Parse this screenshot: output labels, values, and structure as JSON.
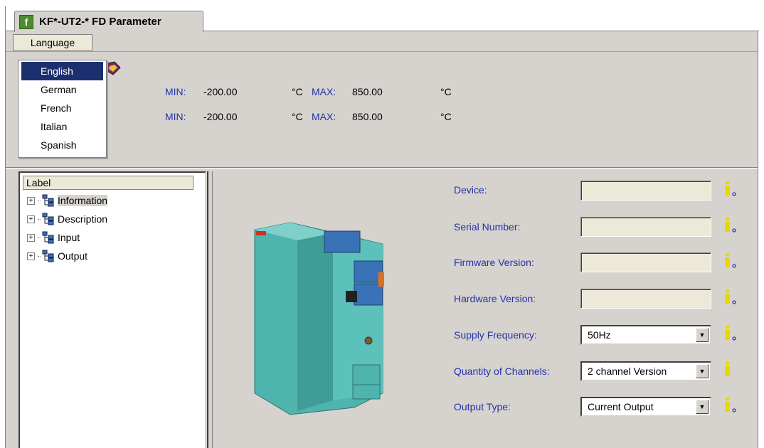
{
  "tab": {
    "logo": "f",
    "title": "KF*-UT2-* FD Parameter"
  },
  "menu": {
    "language_label": "Language"
  },
  "language_menu": {
    "items": [
      "English",
      "German",
      "French",
      "Italian",
      "Spanish"
    ],
    "selected": "English"
  },
  "ranges": [
    {
      "value": "0",
      "min_label": "MIN:",
      "min_value": "-200.00",
      "unit1": "°C",
      "max_label": "MAX:",
      "max_value": "850.00",
      "unit2": "°C"
    },
    {
      "value": "0",
      "min_label": "MIN:",
      "min_value": "-200.00",
      "unit1": "°C",
      "max_label": "MAX:",
      "max_value": "850.00",
      "unit2": "°C"
    }
  ],
  "tree": {
    "header": "Label",
    "items": [
      "Information",
      "Description",
      "Input",
      "Output"
    ],
    "selected": "Information"
  },
  "fields": {
    "device": {
      "label": "Device:",
      "value": ""
    },
    "serial_number": {
      "label": "Serial Number:",
      "value": ""
    },
    "firmware_version": {
      "label": "Firmware Version:",
      "value": ""
    },
    "hardware_version": {
      "label": "Hardware Version:",
      "value": ""
    },
    "supply_frequency": {
      "label": "Supply Frequency:",
      "value": "50Hz"
    },
    "quantity_of_channels": {
      "label": "Quantity of Channels:",
      "value": "2 channel Version"
    },
    "output_type": {
      "label": "Output Type:",
      "value": "Current Output"
    }
  },
  "colors": {
    "label_blue": "#2233aa",
    "highlight": "#1c2f6f",
    "panel": "#d6d3ce",
    "info_yellow": "#e8d800",
    "device_teal": "#4fb3ae"
  },
  "icons": {
    "tab_logo": "pepperl-fuchs-logo-icon",
    "top": "book-icon",
    "tree_node": "tree-node-icon",
    "info": "info-icon",
    "dropdown": "chevron-down-icon"
  }
}
